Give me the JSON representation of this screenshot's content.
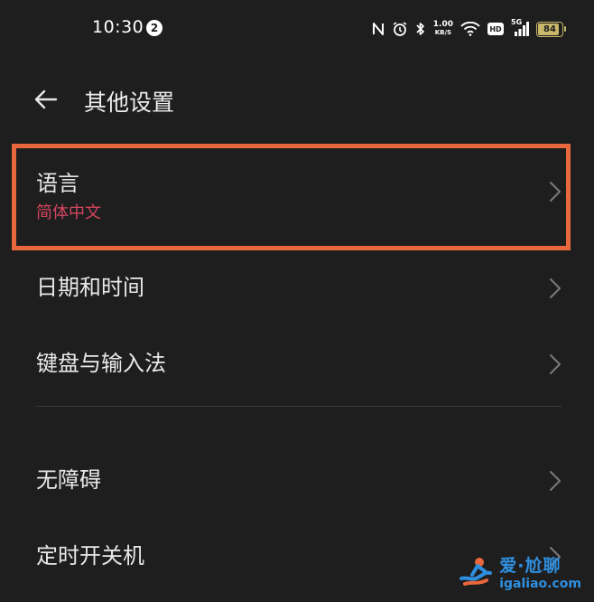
{
  "status_bar": {
    "time": "10:30",
    "notification_count": "2",
    "net_speed_value": "1.00",
    "net_speed_unit": "KB/S",
    "hd_label": "HD",
    "signal_label": "5G",
    "battery_level": "84",
    "icons": [
      "nfc-icon",
      "alarm-icon",
      "bluetooth-icon",
      "wifi-icon",
      "signal-icon",
      "battery-icon"
    ]
  },
  "header": {
    "back_icon": "arrow-left-icon",
    "title": "其他设置"
  },
  "list": {
    "items": [
      {
        "label": "语言",
        "value": "简体中文"
      },
      {
        "label": "日期和时间"
      },
      {
        "label": "键盘与输入法"
      },
      {
        "label": "无障碍"
      },
      {
        "label": "定时开关机"
      }
    ]
  },
  "colors": {
    "background": "#1e1e1e",
    "accent_value": "#d4455f",
    "highlight_border": "#e8673c",
    "battery": "#c9b86a",
    "watermark": "#2f8fe0"
  },
  "watermark": {
    "main": "爱·尬聊",
    "url": "igaliao.com"
  }
}
